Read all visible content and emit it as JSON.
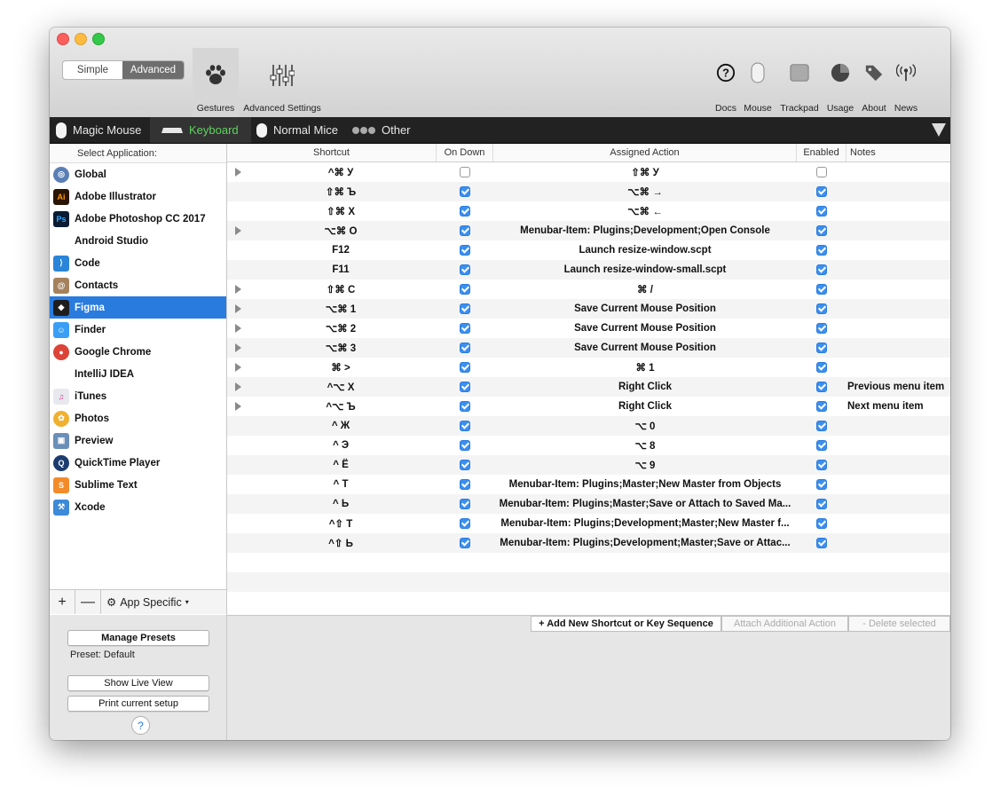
{
  "mode_toggle": {
    "simple_label": "Simple",
    "advanced_label": "Advanced",
    "selected": "Advanced"
  },
  "toolbar": {
    "gestures_label": "Gestures",
    "advanced_settings_label": "Advanced Settings",
    "right_items": [
      {
        "label": "Docs",
        "icon": "question-circle-icon"
      },
      {
        "label": "Mouse",
        "icon": "mouse-icon"
      },
      {
        "label": "Trackpad",
        "icon": "trackpad-icon"
      },
      {
        "label": "Usage",
        "icon": "pie-chart-icon"
      },
      {
        "label": "About",
        "icon": "tags-icon"
      },
      {
        "label": "News",
        "icon": "broadcast-icon"
      }
    ]
  },
  "device_tabs": [
    {
      "label": "Magic Mouse",
      "icon": "magic-mouse-icon",
      "active": false
    },
    {
      "label": "Keyboard",
      "icon": "keyboard-icon",
      "active": true
    },
    {
      "label": "Normal Mice",
      "icon": "mouse-icon",
      "active": false
    },
    {
      "label": "Other",
      "icon": "dots-icon",
      "active": false
    }
  ],
  "sidebar": {
    "header": "Select Application:",
    "apps": [
      {
        "label": "Global",
        "icon": "globe-icon",
        "color": "#5a7fb5"
      },
      {
        "label": "Adobe Illustrator",
        "icon": "illustrator-icon",
        "color": "#2a1403"
      },
      {
        "label": "Adobe Photoshop CC 2017",
        "icon": "photoshop-icon",
        "color": "#0a1b33"
      },
      {
        "label": "Android Studio",
        "icon": "",
        "color": ""
      },
      {
        "label": "Code",
        "icon": "vscode-icon",
        "color": "#2a84d8"
      },
      {
        "label": "Contacts",
        "icon": "contacts-icon",
        "color": "#a5825c"
      },
      {
        "label": "Figma",
        "icon": "figma-icon",
        "color": "#1e1e1e"
      },
      {
        "label": "Finder",
        "icon": "finder-icon",
        "color": "#3b9ef5"
      },
      {
        "label": "Google Chrome",
        "icon": "chrome-icon",
        "color": "#db4437"
      },
      {
        "label": "IntelliJ IDEA",
        "icon": "",
        "color": ""
      },
      {
        "label": "iTunes",
        "icon": "itunes-icon",
        "color": "#e8e8ef"
      },
      {
        "label": "Photos",
        "icon": "photos-icon",
        "color": "#f0b030"
      },
      {
        "label": "Preview",
        "icon": "preview-icon",
        "color": "#6a8fb8"
      },
      {
        "label": "QuickTime Player",
        "icon": "quicktime-icon",
        "color": "#1c3c70"
      },
      {
        "label": "Sublime Text",
        "icon": "sublime-icon",
        "color": "#f38b2a"
      },
      {
        "label": "Xcode",
        "icon": "xcode-icon",
        "color": "#3c8ad8"
      }
    ],
    "selected": "Figma",
    "footer": {
      "add_label": "+",
      "remove_label": "—",
      "app_specific_label": "App Specific"
    }
  },
  "presets": {
    "manage_label": "Manage Presets",
    "preset_text": "Preset: Default",
    "live_view_label": "Show Live View",
    "print_label": "Print current setup",
    "help_label": "?"
  },
  "table": {
    "headers": {
      "shortcut": "Shortcut",
      "on_down": "On Down",
      "action": "Assigned Action",
      "enabled": "Enabled",
      "notes": "Notes"
    },
    "rows": [
      {
        "shortcut": "^⌘ У",
        "on_down": false,
        "action": "⇧⌘ У",
        "enabled": false,
        "notes": "",
        "expand": true
      },
      {
        "shortcut": "⇧⌘ Ъ",
        "on_down": true,
        "action": "⌥⌘ →",
        "enabled": true,
        "notes": "",
        "expand": false
      },
      {
        "shortcut": "⇧⌘ Х",
        "on_down": true,
        "action": "⌥⌘ ←",
        "enabled": true,
        "notes": "",
        "expand": false
      },
      {
        "shortcut": "⌥⌘ O",
        "on_down": true,
        "action": "Menubar-Item: Plugins;Development;Open Console",
        "enabled": true,
        "notes": "",
        "expand": true
      },
      {
        "shortcut": "F12",
        "on_down": true,
        "action": "Launch resize-window.scpt",
        "enabled": true,
        "notes": "",
        "expand": false
      },
      {
        "shortcut": "F11",
        "on_down": true,
        "action": "Launch resize-window-small.scpt",
        "enabled": true,
        "notes": "",
        "expand": false
      },
      {
        "shortcut": "⇧⌘ C",
        "on_down": true,
        "action": "⌘ /",
        "enabled": true,
        "notes": "",
        "expand": true
      },
      {
        "shortcut": "⌥⌘ 1",
        "on_down": true,
        "action": "Save Current Mouse Position",
        "enabled": true,
        "notes": "",
        "expand": true
      },
      {
        "shortcut": "⌥⌘ 2",
        "on_down": true,
        "action": "Save Current Mouse Position",
        "enabled": true,
        "notes": "",
        "expand": true
      },
      {
        "shortcut": "⌥⌘ 3",
        "on_down": true,
        "action": "Save Current Mouse Position",
        "enabled": true,
        "notes": "",
        "expand": true
      },
      {
        "shortcut": "⌘ >",
        "on_down": true,
        "action": "⌘ 1",
        "enabled": true,
        "notes": "",
        "expand": true
      },
      {
        "shortcut": "^⌥ Х",
        "on_down": true,
        "action": "Right Click",
        "enabled": true,
        "notes": "Previous menu item",
        "expand": true
      },
      {
        "shortcut": "^⌥ Ъ",
        "on_down": true,
        "action": "Right Click",
        "enabled": true,
        "notes": "Next menu item",
        "expand": true
      },
      {
        "shortcut": "^ Ж",
        "on_down": true,
        "action": "⌥ 0",
        "enabled": true,
        "notes": "",
        "expand": false
      },
      {
        "shortcut": "^ Э",
        "on_down": true,
        "action": "⌥ 8",
        "enabled": true,
        "notes": "",
        "expand": false
      },
      {
        "shortcut": "^ Ё",
        "on_down": true,
        "action": "⌥ 9",
        "enabled": true,
        "notes": "",
        "expand": false
      },
      {
        "shortcut": "^ Т",
        "on_down": true,
        "action": "Menubar-Item: Plugins;Master;New Master from Objects",
        "enabled": true,
        "notes": "",
        "expand": false
      },
      {
        "shortcut": "^ Ь",
        "on_down": true,
        "action": "Menubar-Item: Plugins;Master;Save or Attach to Saved Ma...",
        "enabled": true,
        "notes": "",
        "expand": false
      },
      {
        "shortcut": "^⇧ Т",
        "on_down": true,
        "action": "Menubar-Item: Plugins;Development;Master;New Master f...",
        "enabled": true,
        "notes": "",
        "expand": false
      },
      {
        "shortcut": "^⇧ Ь",
        "on_down": true,
        "action": "Menubar-Item: Plugins;Development;Master;Save or Attac...",
        "enabled": true,
        "notes": "",
        "expand": false
      }
    ]
  },
  "actions": {
    "add_label": "+ Add New Shortcut or Key Sequence",
    "attach_label": "Attach Additional Action",
    "delete_label": "- Delete selected"
  },
  "colors": {
    "selection": "#2a7bde",
    "checkbox": "#3b8ff0",
    "active_tab_text": "#5fd35f",
    "tabbar": "#222222"
  }
}
